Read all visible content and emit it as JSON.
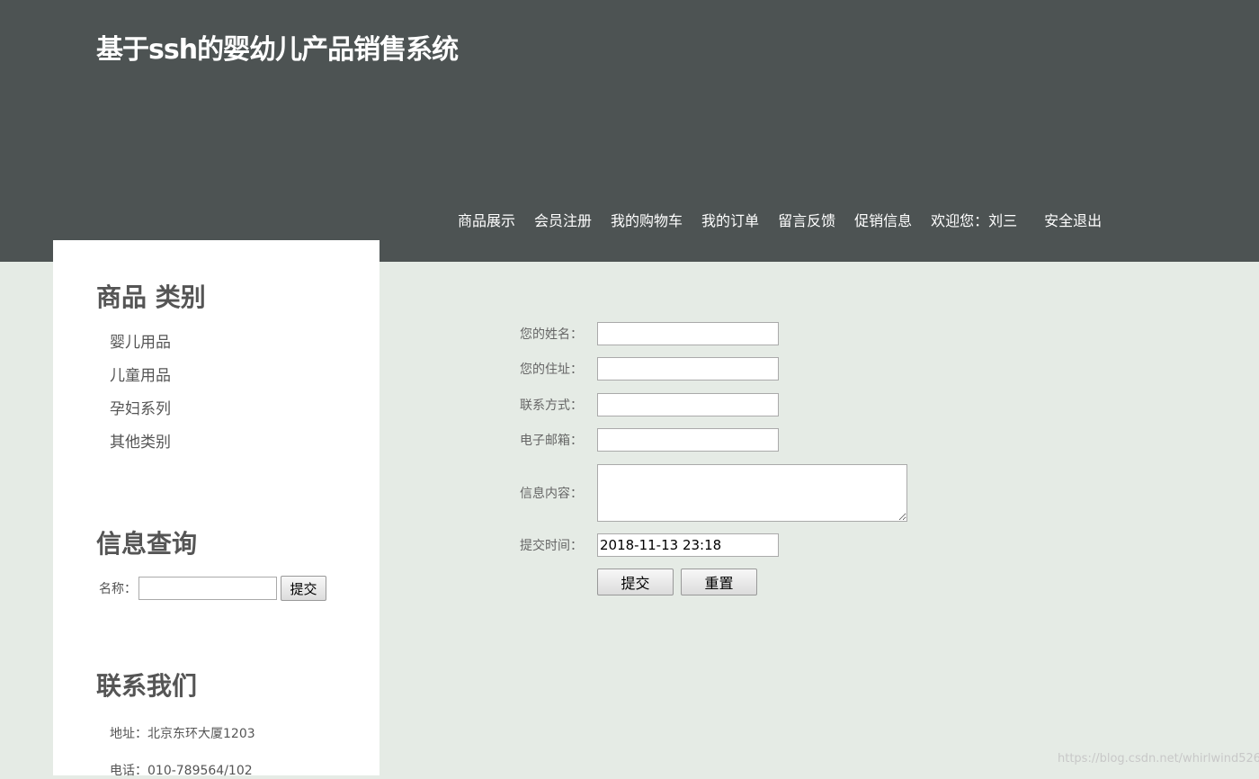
{
  "header": {
    "title": "基于ssh的婴幼儿产品销售系统",
    "nav": [
      "商品展示",
      "会员注册",
      "我的购物车",
      "我的订单",
      "留言反馈",
      "促销信息"
    ],
    "welcome": "欢迎您：刘三",
    "logout": "安全退出"
  },
  "sidebar": {
    "categories_title": "商品 类别",
    "categories": [
      "婴儿用品",
      "儿童用品",
      "孕妇系列",
      "其他类别"
    ],
    "search_title": "信息查询",
    "search_label": "名称：",
    "search_value": "",
    "search_button": "提交",
    "contact_title": "联系我们",
    "address": "地址：北京东环大厦1203",
    "phone": "电话：010-789564/102"
  },
  "form": {
    "name_label": "您的姓名：",
    "name_value": "",
    "address_label": "您的住址：",
    "address_value": "",
    "contact_label": "联系方式：",
    "contact_value": "",
    "email_label": "电子邮箱：",
    "email_value": "",
    "content_label": "信息内容：",
    "content_value": "",
    "time_label": "提交时间：",
    "time_value": "2018-11-13 23:18",
    "submit_button": "提交",
    "reset_button": "重置"
  },
  "watermark": "https://blog.csdn.net/whirlwind526",
  "colors": {
    "header_bg": "#4d5353",
    "page_bg": "#e5ebe5",
    "sidebar_bg": "#ffffff"
  }
}
